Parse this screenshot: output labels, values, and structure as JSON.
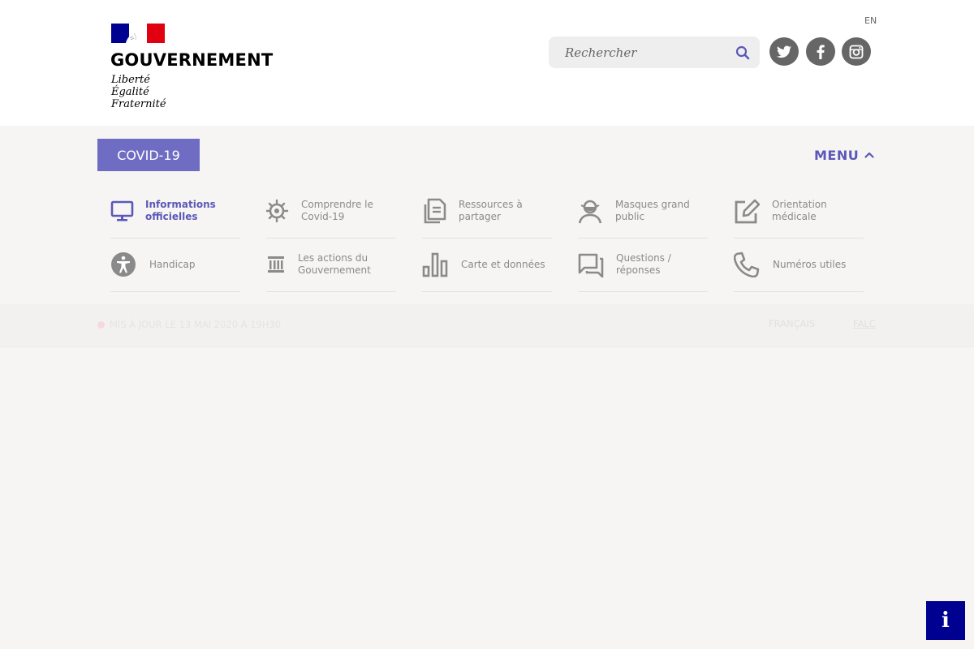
{
  "header": {
    "logo_wordmark": "GOUVERNEMENT",
    "motto": [
      "Liberté",
      "Égalité",
      "Fraternité"
    ],
    "lang_switch": "EN",
    "search": {
      "placeholder": "Rechercher",
      "value": "",
      "icon": "search-icon"
    },
    "social": [
      {
        "name": "twitter",
        "icon": "twitter-icon"
      },
      {
        "name": "facebook",
        "icon": "facebook-icon"
      },
      {
        "name": "instagram",
        "icon": "instagram-icon"
      }
    ]
  },
  "nav": {
    "covid_label": "COVID-19",
    "menu_label": "MENU",
    "items": [
      {
        "label": "Informations officielles",
        "icon": "monitor-icon",
        "active": true
      },
      {
        "label": "Comprendre le Covid-19",
        "icon": "virus-icon"
      },
      {
        "label": "Ressources à partager",
        "icon": "documents-icon"
      },
      {
        "label": "Masques grand public",
        "icon": "mask-icon"
      },
      {
        "label": "Orientation médicale",
        "icon": "edit-icon"
      },
      {
        "label": "Handicap",
        "icon": "accessibility-icon"
      },
      {
        "label": "Les actions du Gouvernement",
        "icon": "government-building-icon"
      },
      {
        "label": "Carte et données",
        "icon": "bar-chart-icon"
      },
      {
        "label": "Questions / réponses",
        "icon": "chat-icon"
      },
      {
        "label": "Numéros utiles",
        "icon": "phone-icon"
      }
    ]
  },
  "status": {
    "update_text": "Mis à jour le 13 mai 2020 à 19h30",
    "lang_fr": "Français",
    "lang_falc": "FALC"
  },
  "info_button": "i",
  "colors": {
    "accent": "#6f6cc4",
    "accent_text": "#5b58b8",
    "info_button": "#000091",
    "flag_blue": "#000091",
    "flag_red": "#e1000f"
  }
}
